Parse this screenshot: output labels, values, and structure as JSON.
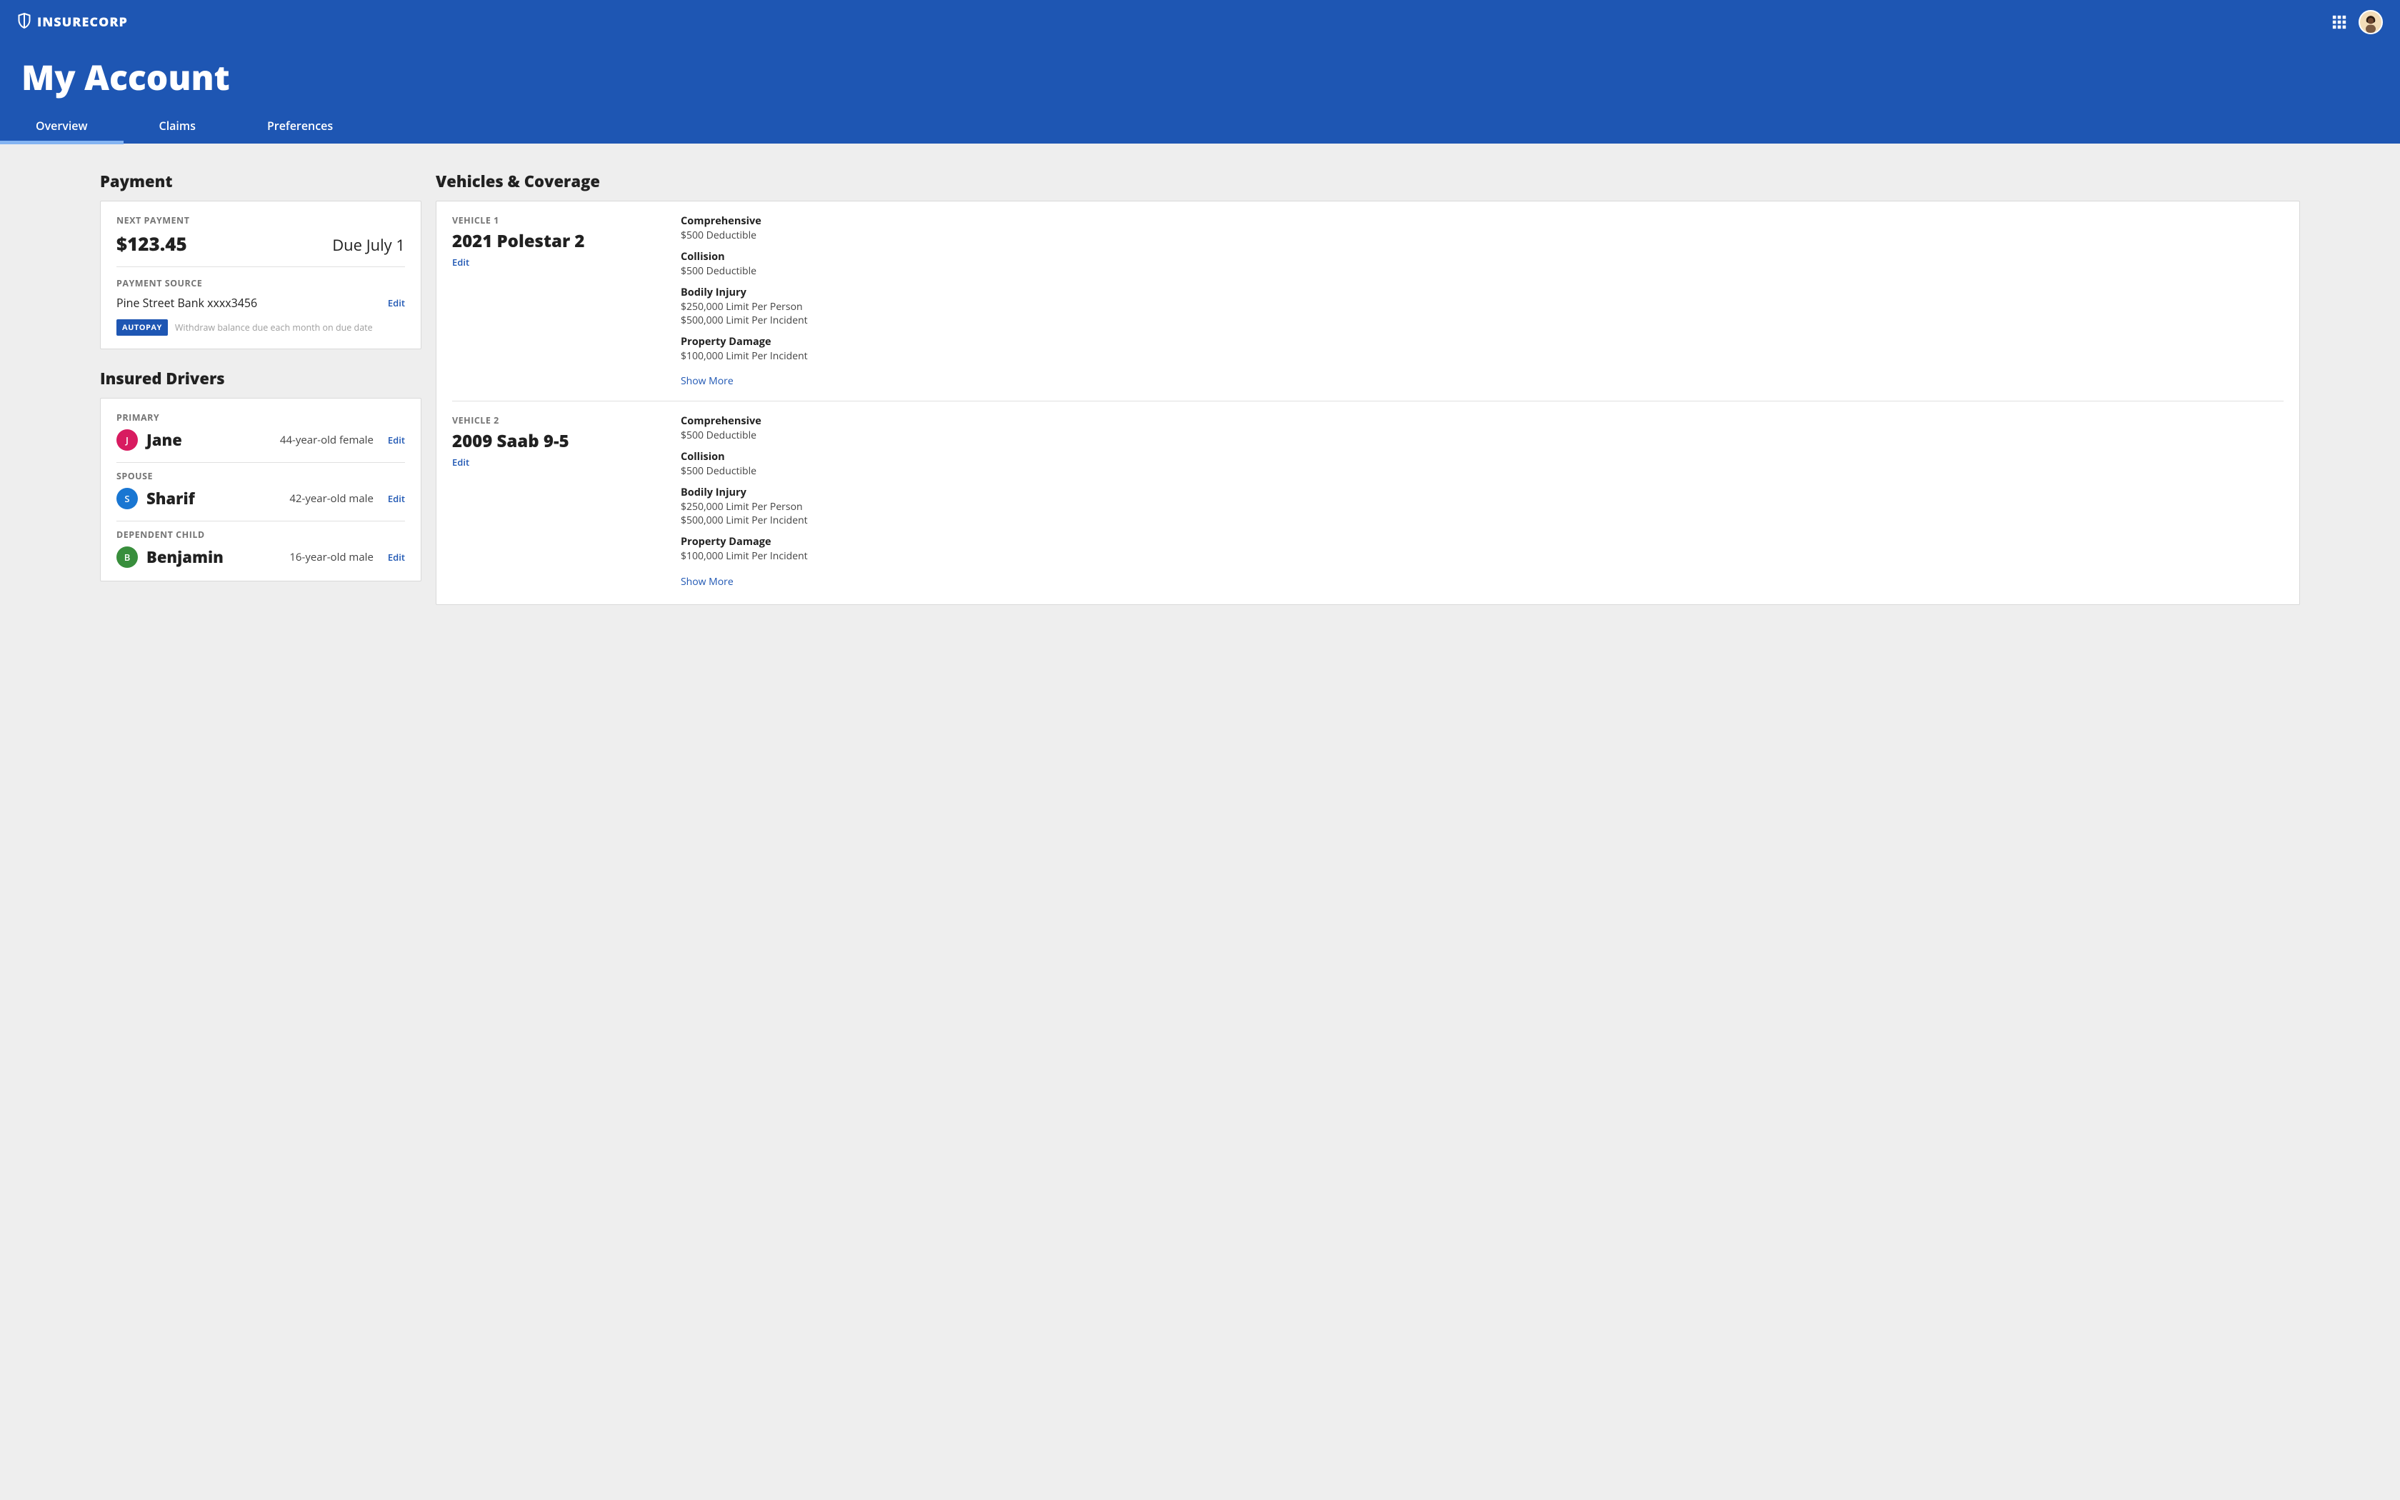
{
  "brand": "INSURECORP",
  "page_title": "My Account",
  "tabs": [
    "Overview",
    "Claims",
    "Preferences"
  ],
  "payment": {
    "section_title": "Payment",
    "next_label": "NEXT PAYMENT",
    "amount": "$123.45",
    "due": "Due July 1",
    "source_label": "PAYMENT SOURCE",
    "source": "Pine Street Bank xxxx3456",
    "edit": "Edit",
    "autopay_badge": "AUTOPAY",
    "autopay_desc": "Withdraw balance due each month on due date"
  },
  "drivers": {
    "section_title": "Insured Drivers",
    "edit": "Edit",
    "items": [
      {
        "role": "PRIMARY",
        "initial": "J",
        "name": "Jane",
        "desc": "44-year-old female",
        "color": "c-pink"
      },
      {
        "role": "SPOUSE",
        "initial": "S",
        "name": "Sharif",
        "desc": "42-year-old male",
        "color": "c-blue"
      },
      {
        "role": "DEPENDENT CHILD",
        "initial": "B",
        "name": "Benjamin",
        "desc": "16-year-old male",
        "color": "c-green"
      }
    ]
  },
  "vehicles": {
    "section_title": "Vehicles & Coverage",
    "edit": "Edit",
    "show_more": "Show More",
    "items": [
      {
        "label": "VEHICLE 1",
        "name": "2021 Polestar 2",
        "coverages": [
          {
            "title": "Comprehensive",
            "detail": "$500 Deductible"
          },
          {
            "title": "Collision",
            "detail": "$500 Deductible"
          },
          {
            "title": "Bodily Injury",
            "detail": "$250,000 Limit Per Person\n$500,000 Limit Per Incident"
          },
          {
            "title": "Property Damage",
            "detail": "$100,000 Limit Per Incident"
          }
        ]
      },
      {
        "label": "VEHICLE 2",
        "name": "2009 Saab 9-5",
        "coverages": [
          {
            "title": "Comprehensive",
            "detail": "$500 Deductible"
          },
          {
            "title": "Collision",
            "detail": "$500 Deductible"
          },
          {
            "title": "Bodily Injury",
            "detail": "$250,000 Limit Per Person\n$500,000 Limit Per Incident"
          },
          {
            "title": "Property Damage",
            "detail": "$100,000 Limit Per Incident"
          }
        ]
      }
    ]
  }
}
